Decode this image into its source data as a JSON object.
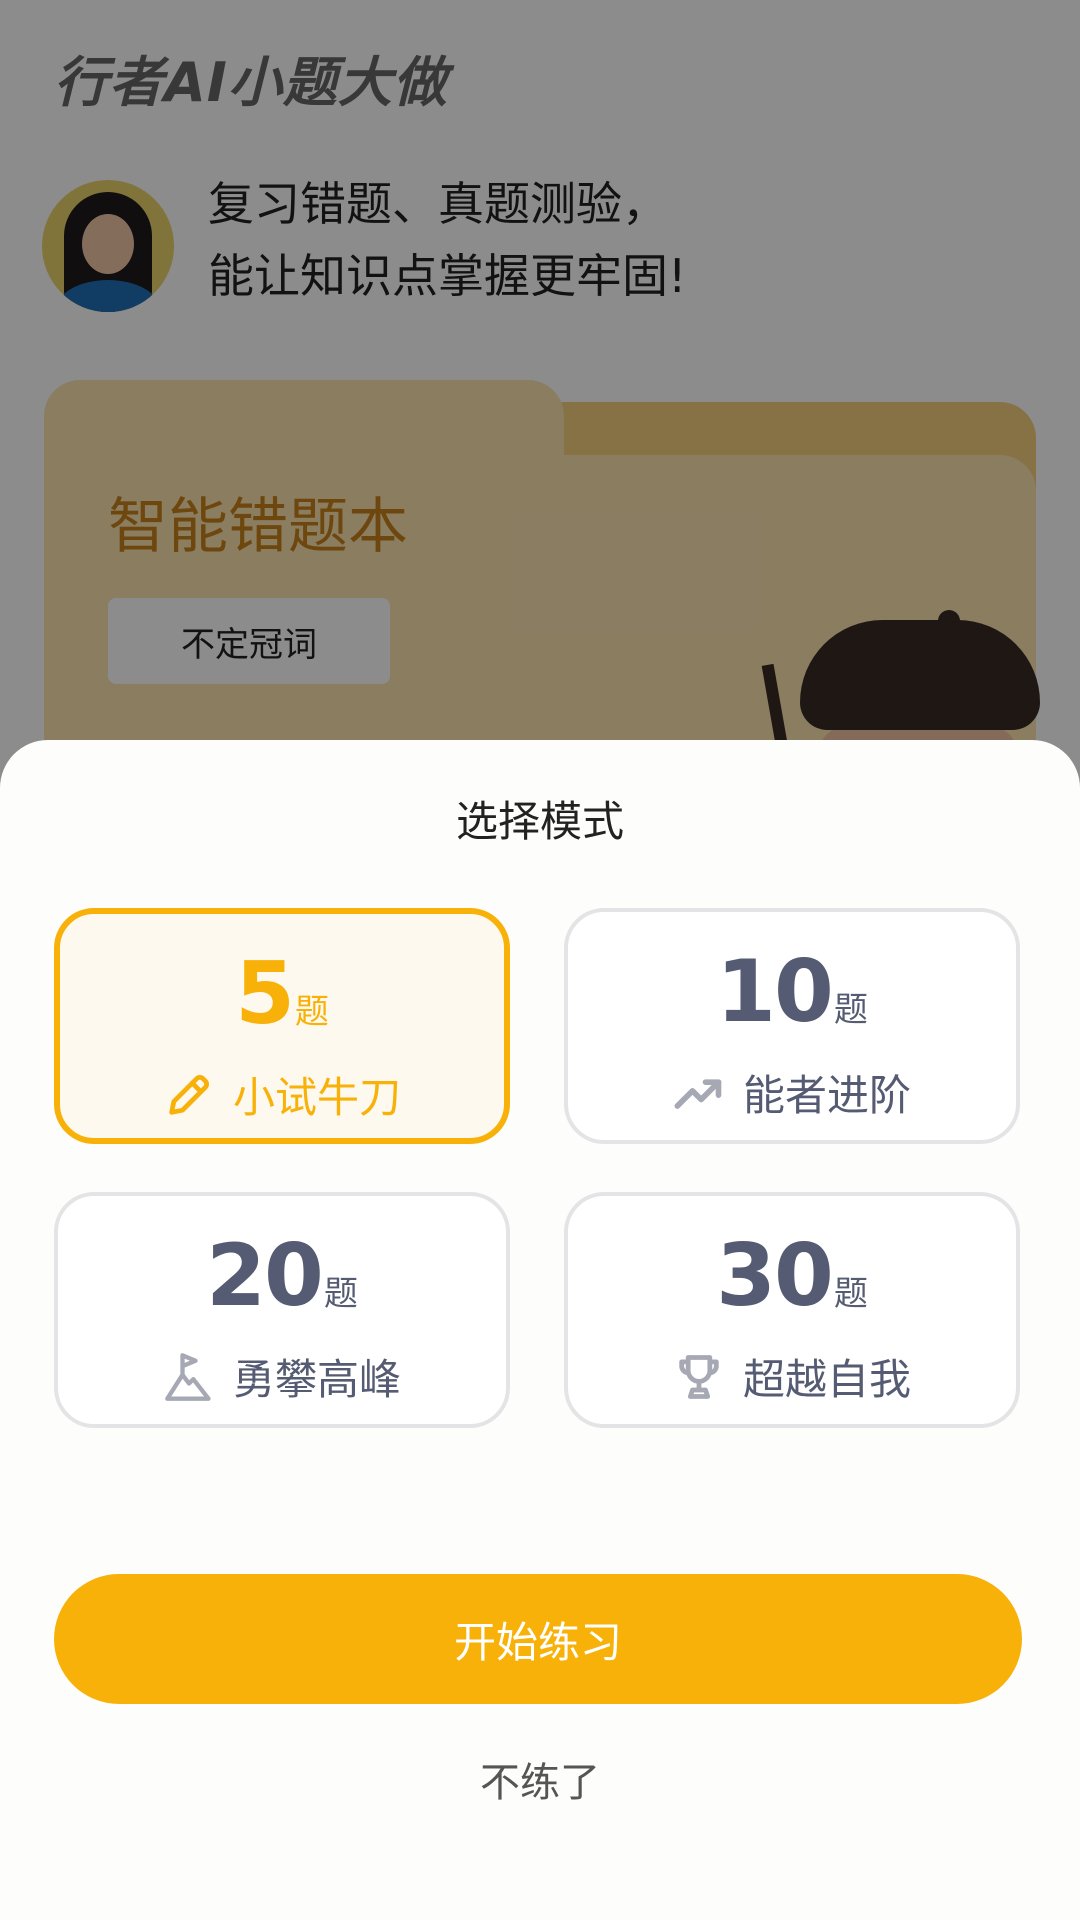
{
  "background": {
    "app_title": "行者AI小题大做",
    "greeting_line1": "复习错题、真题测验，",
    "greeting_line2": "能让知识点掌握更牢固!",
    "folder_title": "智能错题本",
    "folder_tag": "不定冠词"
  },
  "sheet": {
    "title": "选择模式",
    "modes": [
      {
        "count": "5",
        "unit": "题",
        "label": "小试牛刀",
        "icon": "pencil-icon",
        "selected": true
      },
      {
        "count": "10",
        "unit": "题",
        "label": "能者进阶",
        "icon": "trend-up-icon",
        "selected": false
      },
      {
        "count": "20",
        "unit": "题",
        "label": "勇攀高峰",
        "icon": "mountain-flag-icon",
        "selected": false
      },
      {
        "count": "30",
        "unit": "题",
        "label": "超越自我",
        "icon": "trophy-icon",
        "selected": false
      }
    ],
    "start_label": "开始练习",
    "quit_label": "不练了"
  },
  "colors": {
    "accent": "#f8b109",
    "text_muted": "#555b72",
    "card_border": "#e4e4e6"
  }
}
